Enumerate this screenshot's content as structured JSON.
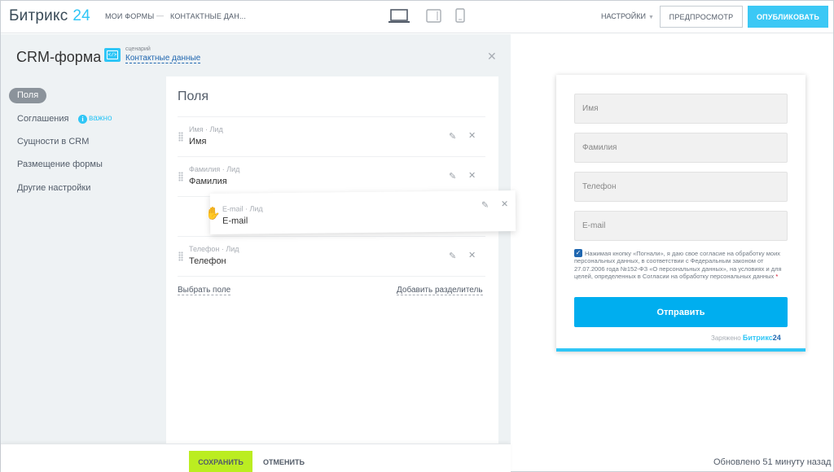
{
  "header": {
    "logo_text": "Битрикс",
    "logo_num": "24",
    "breadcrumbs": [
      "МОИ ФОРМЫ",
      "КОНТАКТНЫЕ ДАН..."
    ],
    "breadcrumb_sep": "—",
    "devices": [
      "desktop-icon",
      "tablet-icon",
      "mobile-icon"
    ],
    "settings_label": "НАСТРОЙКИ",
    "preview_label": "ПРЕДПРОСМОТР",
    "publish_label": "ОПУБЛИКОВАТЬ"
  },
  "editor": {
    "title": "CRM-форма",
    "scenario_label": "сценарий",
    "scenario_value": "Контактные данные",
    "menu": [
      {
        "label": "Поля",
        "active": true
      },
      {
        "label": "Соглашения",
        "badge": "важно"
      },
      {
        "label": "Сущности в CRM"
      },
      {
        "label": "Размещение формы"
      },
      {
        "label": "Другие настройки"
      }
    ],
    "fields_title": "Поля",
    "fields": [
      {
        "meta": "Имя · Лид",
        "name": "Имя"
      },
      {
        "meta": "Фамилия · Лид",
        "name": "Фамилия"
      },
      {
        "meta": "E-mail · Лид",
        "name": "E-mail",
        "dragging": true
      },
      {
        "meta": "Телефон · Лид",
        "name": "Телефон"
      }
    ],
    "choose_field": "Выбрать поле",
    "add_separator": "Добавить разделитель"
  },
  "footer": {
    "save_label": "СОХРАНИТЬ",
    "cancel_label": "ОТМЕНИТЬ",
    "updated": "Обновлено 51 минуту назад"
  },
  "preview": {
    "placeholders": [
      "Имя",
      "Фамилия",
      "Телефон",
      "E-mail"
    ],
    "consent_text": "Нажимая кнопку «Погнали», я даю свое согласие на обработку моих персональных данных, в соответствии с Федеральным законом от 27.07.2006 года №152-ФЗ «О персональных данных», на условиях и для целей, определенных в Согласии на обработку персональных данных",
    "consent_star": "*",
    "consent_checked": true,
    "submit_label": "Отправить",
    "powered_label": "Заряжено",
    "powered_brand": "Битрикс",
    "powered_num": "24"
  },
  "colors": {
    "accent": "#2fc6f6",
    "publish": "#3bc8f5",
    "save": "#bbed21",
    "submit": "#00aeef"
  }
}
